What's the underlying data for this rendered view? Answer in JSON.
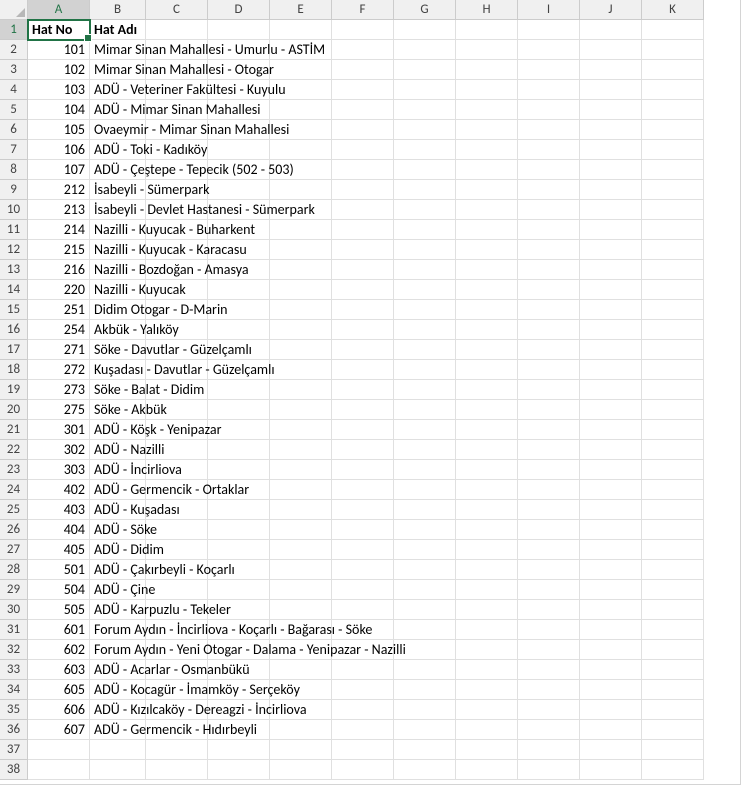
{
  "chart_data": {
    "type": "table",
    "columns": [
      "Hat No",
      "Hat Adı"
    ],
    "rows": [
      [
        101,
        "Mimar Sinan Mahallesi - Umurlu - ASTİM"
      ],
      [
        102,
        "Mimar Sinan Mahallesi - Otogar"
      ],
      [
        103,
        "ADÜ - Veteriner Fakültesi - Kuyulu"
      ],
      [
        104,
        "ADÜ - Mimar Sinan Mahallesi"
      ],
      [
        105,
        "Ovaeymir - Mimar Sinan Mahallesi"
      ],
      [
        106,
        "ADÜ - Toki - Kadıköy"
      ],
      [
        107,
        "ADÜ - Çeştepe - Tepecik (502 - 503)"
      ],
      [
        212,
        "İsabeyli - Sümerpark"
      ],
      [
        213,
        "İsabeyli - Devlet Hastanesi - Sümerpark"
      ],
      [
        214,
        "Nazilli - Kuyucak - Buharkent"
      ],
      [
        215,
        "Nazilli - Kuyucak - Karacasu"
      ],
      [
        216,
        "Nazilli - Bozdoğan - Amasya"
      ],
      [
        220,
        "Nazilli - Kuyucak"
      ],
      [
        251,
        "Didim Otogar - D-Marin"
      ],
      [
        254,
        "Akbük - Yalıköy"
      ],
      [
        271,
        "Söke - Davutlar - Güzelçamlı"
      ],
      [
        272,
        "Kuşadası - Davutlar - Güzelçamlı"
      ],
      [
        273,
        "Söke - Balat - Didim"
      ],
      [
        275,
        "Söke - Akbük"
      ],
      [
        301,
        "ADÜ - Köşk - Yenipazar"
      ],
      [
        302,
        "ADÜ - Nazilli"
      ],
      [
        303,
        "ADÜ - İncirliova"
      ],
      [
        402,
        "ADÜ - Germencik - Ortaklar"
      ],
      [
        403,
        "ADÜ - Kuşadası"
      ],
      [
        404,
        "ADÜ - Söke"
      ],
      [
        405,
        "ADÜ - Didim"
      ],
      [
        501,
        "ADÜ - Çakırbeyli - Koçarlı"
      ],
      [
        504,
        "ADÜ - Çine"
      ],
      [
        505,
        "ADÜ - Karpuzlu - Tekeler"
      ],
      [
        601,
        "Forum Aydın - İncirliova - Koçarlı - Bağarası - Söke"
      ],
      [
        602,
        "Forum Aydın - Yeni Otogar - Dalama - Yenipazar - Nazilli"
      ],
      [
        603,
        "ADÜ - Acarlar - Osmanbükü"
      ],
      [
        605,
        "ADÜ - Kocagür - İmamköy - Serçeköy"
      ],
      [
        606,
        "ADÜ - Kızılcaköy - Dereagzi - İncirliova"
      ],
      [
        607,
        "ADÜ - Germencik - Hıdırbeyli"
      ]
    ]
  },
  "columns": [
    "A",
    "B",
    "C",
    "D",
    "E",
    "F",
    "G",
    "H",
    "I",
    "J",
    "K"
  ],
  "headers": {
    "A": "Hat No",
    "B": "Hat Adı"
  },
  "total_rows": 38,
  "selected_cell": "A1",
  "active_row": 1,
  "active_col": "A"
}
